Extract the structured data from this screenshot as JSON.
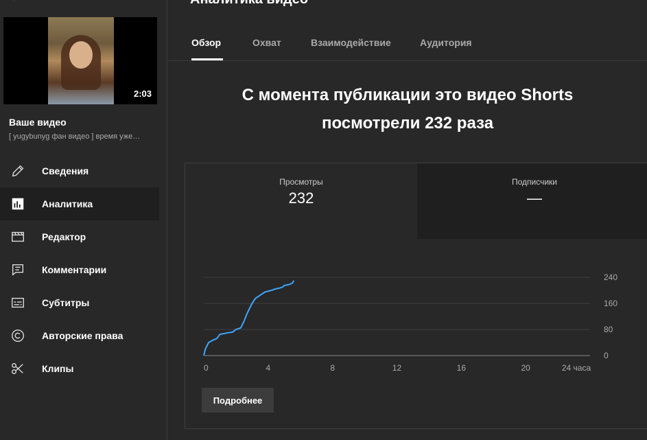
{
  "sidebar": {
    "thumbnail_duration": "2:03",
    "your_video": "Ваше видео",
    "video_title": "[ yugybunyg фан видео ] время уже…",
    "items": [
      {
        "label": "Сведения",
        "icon": "pencil-icon"
      },
      {
        "label": "Аналитика",
        "icon": "analytics-icon"
      },
      {
        "label": "Редактор",
        "icon": "clapperboard-icon"
      },
      {
        "label": "Комментарии",
        "icon": "comment-icon"
      },
      {
        "label": "Субтитры",
        "icon": "subtitles-icon"
      },
      {
        "label": "Авторские права",
        "icon": "copyright-icon"
      },
      {
        "label": "Клипы",
        "icon": "scissors-icon"
      }
    ],
    "active_index": 1
  },
  "main": {
    "title": "Аналитика видео",
    "tabs": [
      {
        "label": "Обзор"
      },
      {
        "label": "Охват"
      },
      {
        "label": "Взаимодействие"
      },
      {
        "label": "Аудитория"
      }
    ],
    "active_tab": 0,
    "headline_line1": "С момента публикации это видео Shorts",
    "headline_line2": "посмотрели 232 раза",
    "metrics": [
      {
        "label": "Просмотры",
        "value": "232"
      },
      {
        "label": "Подписчики",
        "value": "—"
      }
    ],
    "more_button": "Подробнее"
  },
  "colors": {
    "background": "#282828",
    "line": "#3ea6ff",
    "active_nav": "#1f1f1f"
  },
  "chart_data": {
    "type": "line",
    "xlabel": "",
    "ylabel": "",
    "x_ticks": [
      "0",
      "4",
      "8",
      "12",
      "16",
      "20",
      "24 часа"
    ],
    "y_ticks": [
      "0",
      "80",
      "160",
      "240"
    ],
    "xlim": [
      0,
      24
    ],
    "ylim": [
      0,
      240
    ],
    "series": [
      {
        "values": [
          [
            0,
            0
          ],
          [
            0.1,
            20
          ],
          [
            0.3,
            40
          ],
          [
            0.6,
            48
          ],
          [
            0.8,
            52
          ],
          [
            1.0,
            65
          ],
          [
            1.5,
            70
          ],
          [
            1.8,
            72
          ],
          [
            2.0,
            80
          ],
          [
            2.3,
            85
          ],
          [
            2.5,
            105
          ],
          [
            2.7,
            130
          ],
          [
            3.0,
            160
          ],
          [
            3.2,
            175
          ],
          [
            3.5,
            185
          ],
          [
            3.8,
            195
          ],
          [
            4.2,
            200
          ],
          [
            4.5,
            205
          ],
          [
            4.7,
            207
          ],
          [
            4.9,
            210
          ],
          [
            5.0,
            215
          ],
          [
            5.3,
            218
          ],
          [
            5.5,
            222
          ],
          [
            5.6,
            230
          ]
        ]
      }
    ]
  }
}
